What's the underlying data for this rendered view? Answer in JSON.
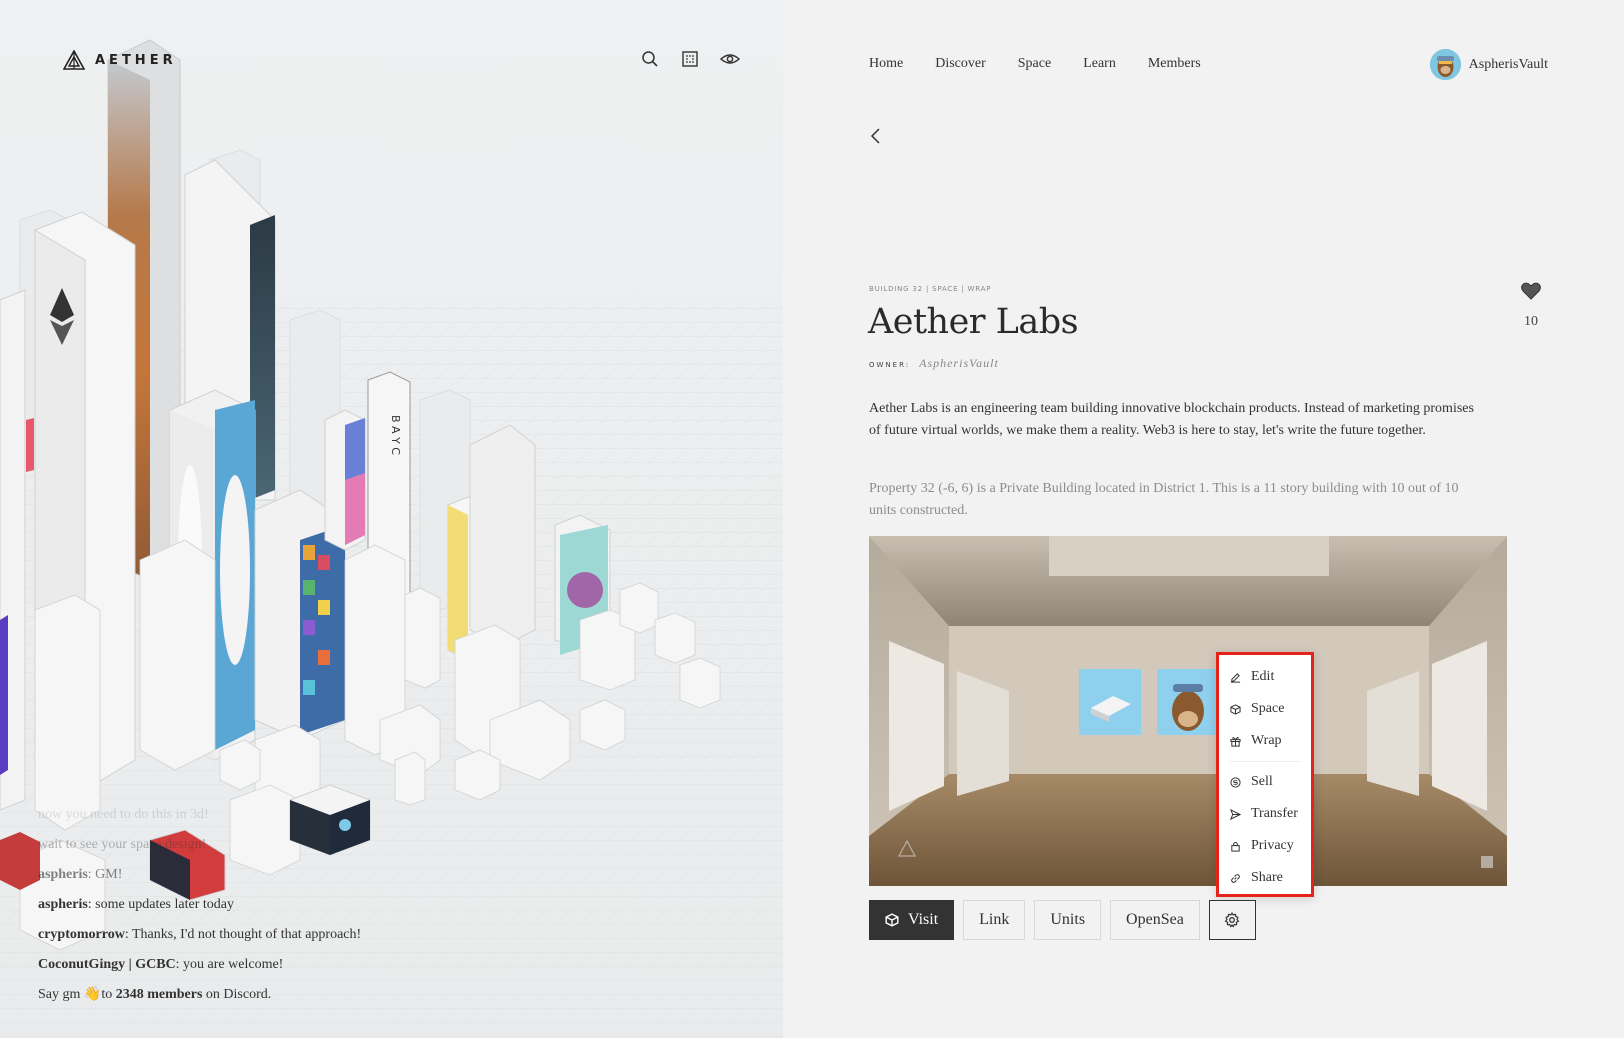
{
  "brand": {
    "name": "AETHER"
  },
  "chat": {
    "lines": [
      {
        "user": "",
        "text": "now you need to do this in 3d!",
        "faded": "faded1"
      },
      {
        "user": "",
        "text": "wait to see your space design!",
        "faded": "faded2"
      },
      {
        "user": "aspheris",
        "text": ": GM!",
        "faded": "faded3"
      },
      {
        "user": "aspheris",
        "text": ": some updates later today",
        "faded": ""
      },
      {
        "user": "cryptomorrow",
        "text": ": Thanks, I'd not thought of that approach!",
        "faded": ""
      },
      {
        "user": "CoconutGingy | GCBC",
        "text": ": you are welcome!",
        "faded": ""
      }
    ],
    "footer_prefix": "Say gm",
    "footer_emoji": "👋",
    "footer_mid": "to",
    "footer_count": "2348 members",
    "footer_suffix": "on Discord."
  },
  "nav": {
    "items": [
      "Home",
      "Discover",
      "Space",
      "Learn",
      "Members"
    ],
    "username": "AspherisVault"
  },
  "property": {
    "meta": "BUILDING 32 | SPACE | WRAP",
    "title": "Aether Labs",
    "owner_label": "OWNER:",
    "owner_name": "AspherisVault",
    "likes": "10",
    "description": "Aether Labs is an engineering team building innovative blockchain products. Instead of marketing promises of future virtual worlds, we make them a reality. Web3 is here to stay, let's write the future together.",
    "details": "Property 32 (-6, 6) is a Private Building located in District 1. This is a 11 story building with 10 out of 10 units constructed."
  },
  "menu": {
    "items": [
      "Edit",
      "Space",
      "Wrap",
      "Sell",
      "Transfer",
      "Privacy",
      "Share"
    ]
  },
  "actions": {
    "visit": "Visit",
    "link": "Link",
    "units": "Units",
    "opensea": "OpenSea"
  },
  "colors": {
    "accent": "#e5221b",
    "primary": "#333333"
  }
}
